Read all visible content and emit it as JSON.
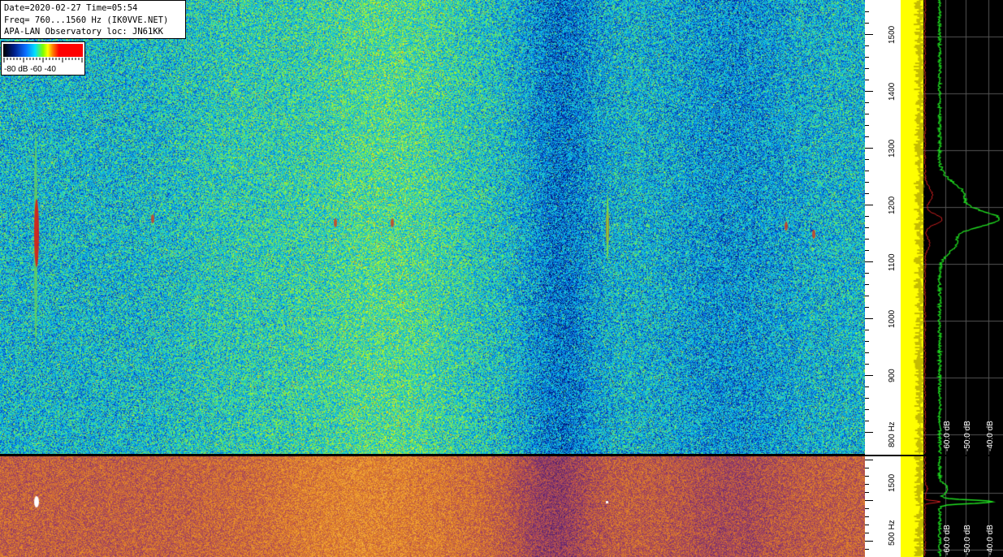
{
  "info": {
    "line1": "Date=2020-02-27 Time=05:54",
    "line2": "Freq= 760...1560 Hz (IK0VVE.NET)",
    "line3": "APA-LAN Observatory loc: JN61KK"
  },
  "legend": {
    "label": "-80 dB -60     -40",
    "colors": [
      "#000000",
      "#001f8a",
      "#0a6cff",
      "#00e0ff",
      "#7cff00",
      "#ffff00",
      "#ff8000",
      "#ff0000"
    ]
  },
  "chart_data": [
    {
      "type": "heatmap",
      "title": "",
      "freq_range": [
        760,
        1560
      ],
      "ylim": [
        760,
        1560
      ],
      "yticks": [
        {
          "value": 800,
          "label": "800 Hz"
        },
        {
          "value": 900,
          "label": "900"
        },
        {
          "value": 1000,
          "label": "1000"
        },
        {
          "value": 1100,
          "label": "1100"
        },
        {
          "value": 1200,
          "label": "1200"
        },
        {
          "value": 1300,
          "label": "1300"
        },
        {
          "value": 1400,
          "label": "1400"
        },
        {
          "value": 1500,
          "label": "1500"
        }
      ],
      "color_scale_db": [
        -80,
        -40
      ],
      "strong_signals_hz": [
        1155,
        1160,
        1175
      ],
      "spectrum_db_labels": [
        "-60.0 dB",
        "-50.0 dB",
        "-40.0 dB"
      ]
    },
    {
      "type": "heatmap",
      "title": "",
      "yticks": [
        {
          "value": 500,
          "label": "500 Hz"
        },
        {
          "value": 1500,
          "label": "1500"
        }
      ],
      "spectrum_db_labels": [
        "-60.0 dB",
        "-50.0 dB",
        "-40.0 dB"
      ]
    }
  ]
}
